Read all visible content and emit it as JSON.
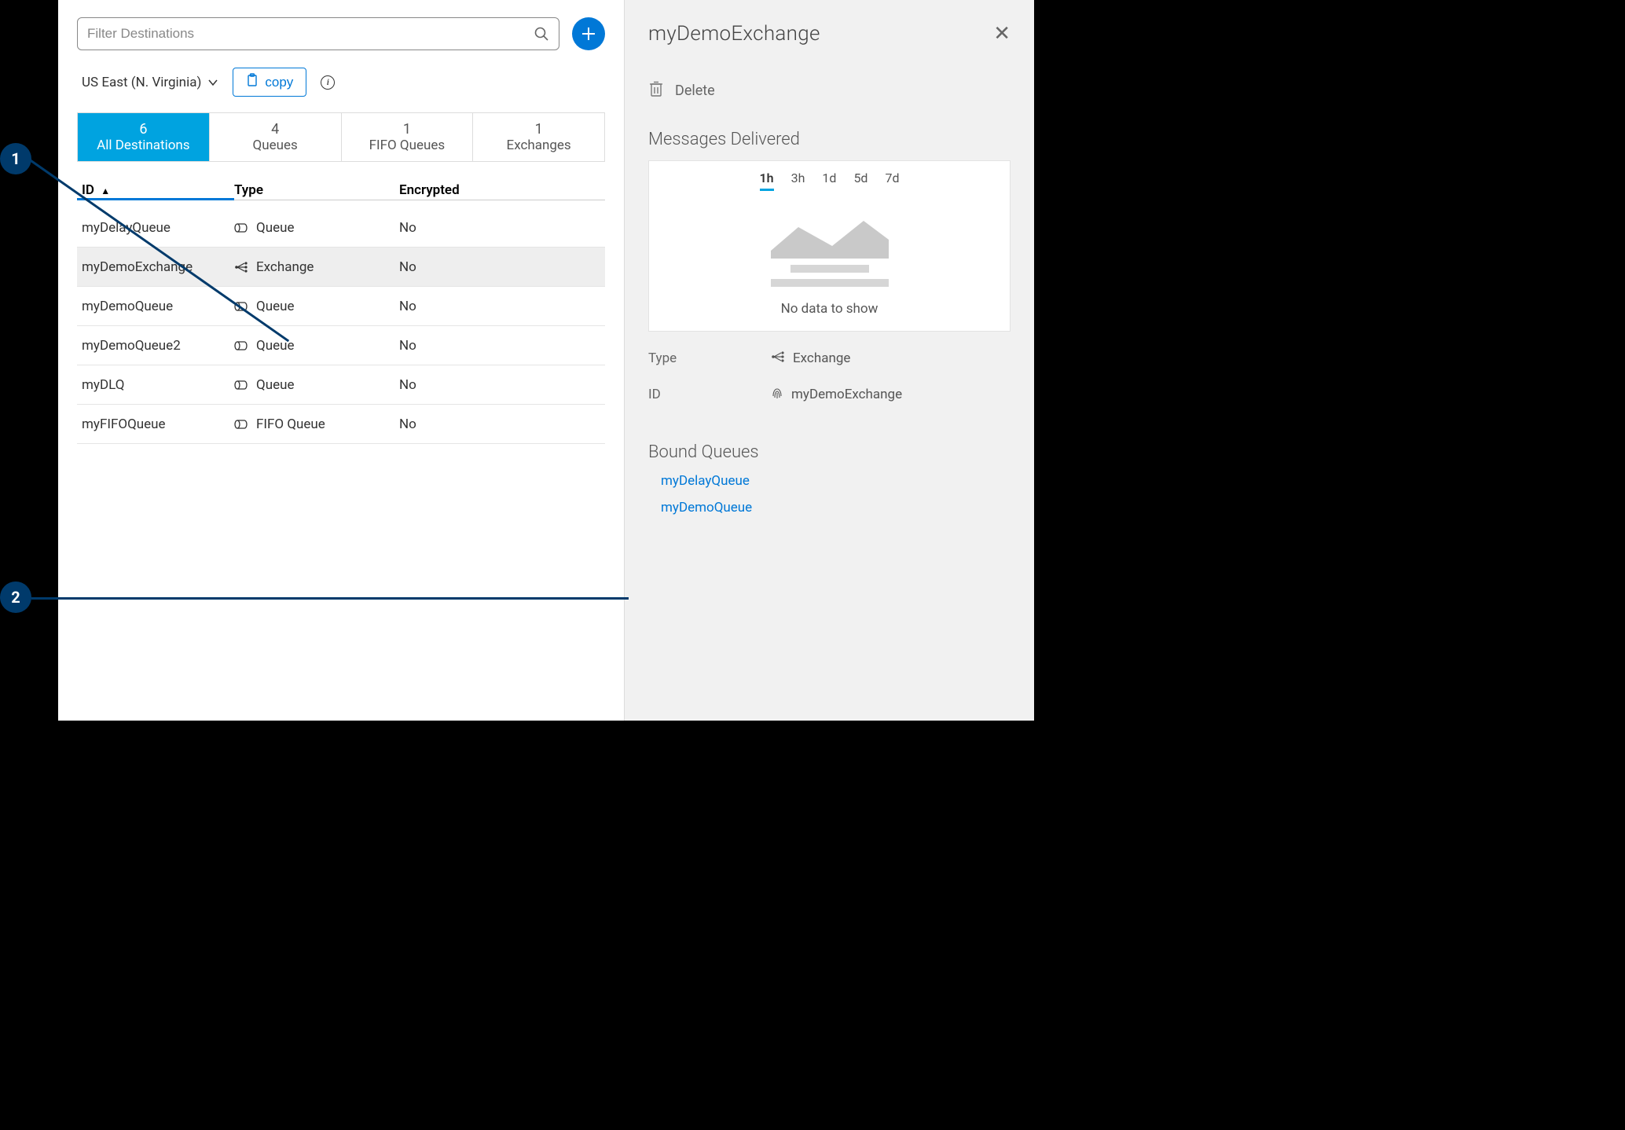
{
  "search": {
    "placeholder": "Filter Destinations"
  },
  "region": {
    "label": "US East (N. Virginia)"
  },
  "copy_button": {
    "label": "copy"
  },
  "tabs": [
    {
      "count": "6",
      "label": "All Destinations",
      "active": true
    },
    {
      "count": "4",
      "label": "Queues",
      "active": false
    },
    {
      "count": "1",
      "label": "FIFO Queues",
      "active": false
    },
    {
      "count": "1",
      "label": "Exchanges",
      "active": false
    }
  ],
  "table": {
    "columns": {
      "id": "ID",
      "type": "Type",
      "encrypted": "Encrypted"
    },
    "rows": [
      {
        "id": "myDelayQueue",
        "type": "Queue",
        "encrypted": "No",
        "icon": "queue",
        "selected": false
      },
      {
        "id": "myDemoExchange",
        "type": "Exchange",
        "encrypted": "No",
        "icon": "exchange",
        "selected": true
      },
      {
        "id": "myDemoQueue",
        "type": "Queue",
        "encrypted": "No",
        "icon": "queue",
        "selected": false
      },
      {
        "id": "myDemoQueue2",
        "type": "Queue",
        "encrypted": "No",
        "icon": "queue",
        "selected": false
      },
      {
        "id": "myDLQ",
        "type": "Queue",
        "encrypted": "No",
        "icon": "queue",
        "selected": false
      },
      {
        "id": "myFIFOQueue",
        "type": "FIFO Queue",
        "encrypted": "No",
        "icon": "queue",
        "selected": false
      }
    ]
  },
  "detail": {
    "title": "myDemoExchange",
    "delete_label": "Delete",
    "messages_heading": "Messages Delivered",
    "timerange": [
      "1h",
      "3h",
      "1d",
      "5d",
      "7d"
    ],
    "timerange_active": "1h",
    "no_data": "No data to show",
    "meta": {
      "type_label": "Type",
      "type_value": "Exchange",
      "id_label": "ID",
      "id_value": "myDemoExchange"
    },
    "bound_heading": "Bound Queues",
    "bound_queues": [
      "myDelayQueue",
      "myDemoQueue"
    ]
  },
  "callouts": {
    "one": "1",
    "two": "2"
  }
}
